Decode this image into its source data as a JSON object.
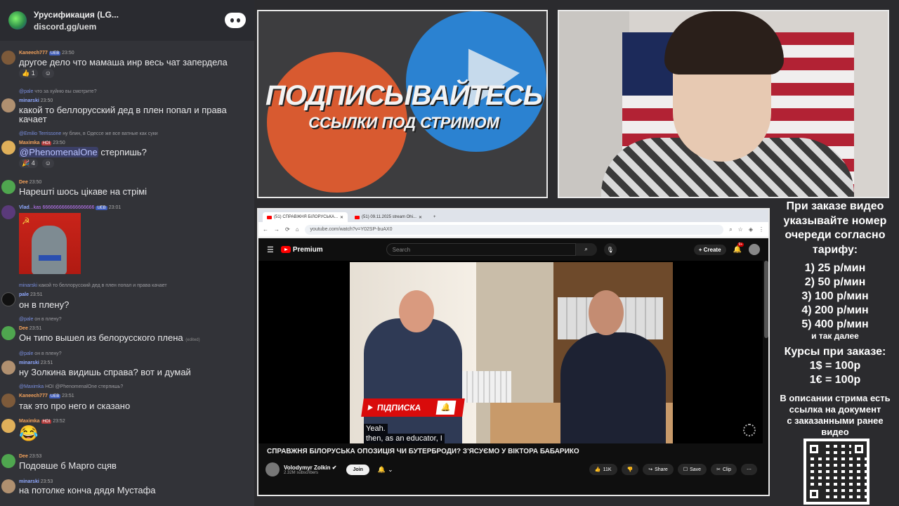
{
  "server": {
    "name": "Урусификация (LG...",
    "invite": "discord.gg/uem"
  },
  "messages": [
    {
      "user": "Kaneech777",
      "badge": "UEB",
      "time": "23:50",
      "text": "другое дело что мамаша инр весь чат запердела",
      "reacts": [
        "1",
        ""
      ]
    },
    {
      "reply_user": "@pale",
      "reply_text": "что за хуйню вы смотрите?",
      "user": "minarski",
      "time": "23:50",
      "text1": "какой то беллорусский дед в плен попал и права",
      "text2": "качает"
    },
    {
      "reply_user": "@Emilio Terrissone",
      "reply_text": "ну блин, в Одессе же все ватные как суки",
      "user": "Maximka",
      "badge": "HOI",
      "time": "23:50",
      "mention": "@PhenomenalOne",
      "text": " стерпишь?",
      "reacts": [
        "4",
        ""
      ]
    },
    {
      "user": "Dee",
      "time": "23:50",
      "text": "Нарешті шось цікаве на стрімі"
    },
    {
      "user": "Vlad",
      "user_suffix": "...kas 6666666666666666666",
      "badge": "UEB",
      "time": "23:01"
    },
    {
      "reply_user": "minarski",
      "reply_text": "какой то беллорусский дед в плен попал и права качает",
      "user": "pale",
      "time": "23:51",
      "text": "он в плену?"
    },
    {
      "reply_user": "@pale",
      "reply_text": "он в плену?",
      "user": "Dee",
      "time": "23:51",
      "text": "Он типо вышел из белорусского плена",
      "edited": "(edited)"
    },
    {
      "reply_user": "@pale",
      "reply_text": "он в плену?",
      "user": "minarski",
      "time": "23:51",
      "text": "ну Золкина видишь справа? вот и думай"
    },
    {
      "reply_user": "@Maximka",
      "reply_text": "HOI @PhenomenalOne стерпишь?",
      "user": "Kaneech777",
      "badge": "UEB",
      "time": "23:51",
      "text": "так это про него и сказано"
    },
    {
      "user": "Maximka",
      "badge": "HOI",
      "time": "23:52",
      "emoji": "😂"
    },
    {
      "user": "Dee",
      "time": "23:53",
      "text": "Подовше б Марго сцяв"
    },
    {
      "user": "minarski",
      "time": "23:53",
      "text": "на потолке конча дядя Мустафа"
    }
  ],
  "promo": {
    "title": "ПОДПИСЫВАЙТЕСЬ",
    "subtitle": "ССЫЛКИ ПОД СТРИМОМ"
  },
  "pricing": {
    "head": [
      "При заказе видео",
      "указывайте номер",
      "очереди согласно",
      "тарифу:"
    ],
    "tiers": [
      "1) 25 р/мин",
      "2) 50 р/мин",
      "3) 100 р/мин",
      "4) 200 р/мин",
      "5) 400 р/мин"
    ],
    "tier_note": "и так далее",
    "rate_head": "Курсы при заказе:",
    "rates": [
      "1$ = 100р",
      "1€ = 100р"
    ],
    "desc": [
      "В описании стрима есть",
      "ссылка на документ",
      "с заказанными ранее",
      "видео"
    ]
  },
  "browser": {
    "tabs": [
      "(51) СПРАВЖНЯ БІЛОРУСЬКА...",
      "(51) 09.11.2025 stream Ohi..."
    ],
    "new_tab": "+",
    "url": "youtube.com/watch?v=Y02SP-buAX0"
  },
  "youtube": {
    "logo": "Premium",
    "search_placeholder": "Search",
    "create": "+ Create",
    "notif_count": "9+",
    "subscribe_overlay": "ПІДПИСКА",
    "caption_line1": "Yeah.",
    "caption_line2": "then, as an educator, I",
    "title": "СПРАВЖНЯ БІЛОРУСЬКА ОПОЗИЦІЯ ЧИ БУТЕРБРОДИ? З'ЯСУЄМО У ВІКТОРА БАБАРИКО",
    "channel": "Volodymyr Zolkin",
    "subs": "2.32M subscribers",
    "join": "Join",
    "likes": "11K",
    "share": "Share",
    "save": "Save",
    "clip": "Clip"
  }
}
